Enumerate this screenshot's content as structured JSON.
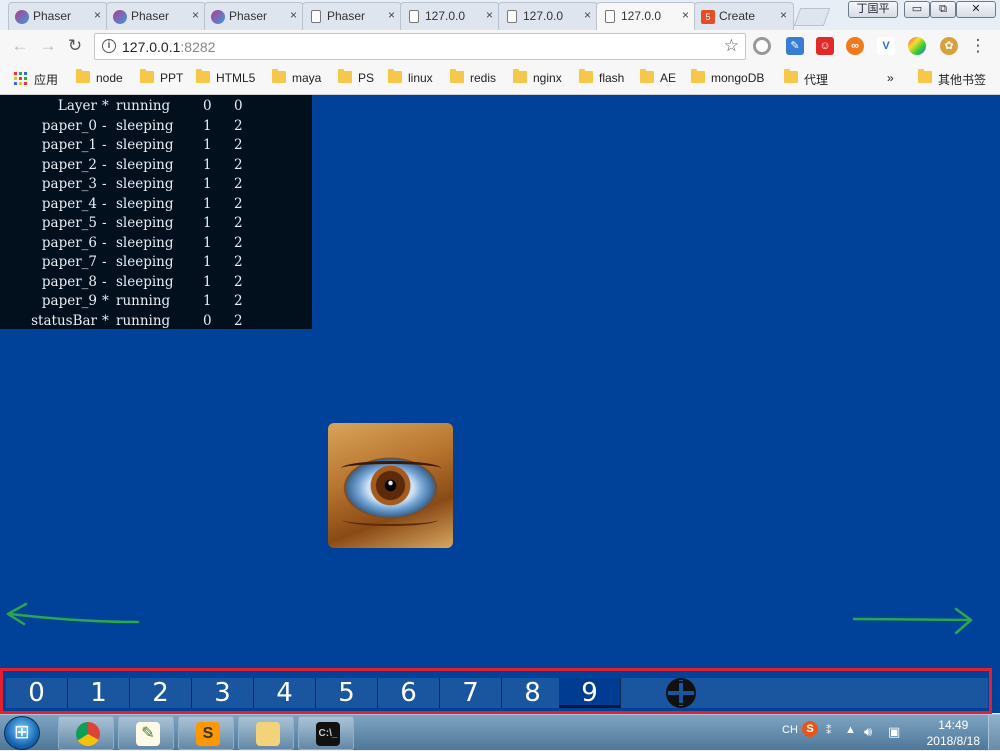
{
  "browser": {
    "tabs": [
      {
        "label": "Phaser",
        "icon": "phaser-icon"
      },
      {
        "label": "Phaser",
        "icon": "phaser-icon"
      },
      {
        "label": "Phaser",
        "icon": "phaser-icon"
      },
      {
        "label": "Phaser",
        "icon": "page-icon"
      },
      {
        "label": "127.0.0",
        "icon": "page-icon"
      },
      {
        "label": "127.0.0",
        "icon": "page-icon"
      },
      {
        "label": "127.0.0",
        "icon": "page-icon",
        "active": true
      },
      {
        "label": "Create",
        "icon": "html5-icon"
      }
    ],
    "tab_close": "×",
    "window_user": "丁国平",
    "window_min": "▭",
    "window_restore": "⧉",
    "window_close": "✕",
    "url_host": "127.0.0.1",
    "url_port": ":8282",
    "star_icon": "☆",
    "menu_icon": "⋮"
  },
  "bookmarks": {
    "apps_label": "应用",
    "items": [
      "node",
      "PPT",
      "HTML5",
      "maya",
      "PS",
      "linux",
      "redis",
      "nginx",
      "flash",
      "AE",
      "mongoDB",
      "代理"
    ],
    "overflow": "»",
    "other_label": "其他书签"
  },
  "debug_panel": {
    "rows": [
      {
        "name": "Layer",
        "sym": "*",
        "state": "running",
        "n1": "0",
        "n2": "0"
      },
      {
        "name": "paper_0",
        "sym": "-",
        "state": "sleeping",
        "n1": "1",
        "n2": "2"
      },
      {
        "name": "paper_1",
        "sym": "-",
        "state": "sleeping",
        "n1": "1",
        "n2": "2"
      },
      {
        "name": "paper_2",
        "sym": "-",
        "state": "sleeping",
        "n1": "1",
        "n2": "2"
      },
      {
        "name": "paper_3",
        "sym": "-",
        "state": "sleeping",
        "n1": "1",
        "n2": "2"
      },
      {
        "name": "paper_4",
        "sym": "-",
        "state": "sleeping",
        "n1": "1",
        "n2": "2"
      },
      {
        "name": "paper_5",
        "sym": "-",
        "state": "sleeping",
        "n1": "1",
        "n2": "2"
      },
      {
        "name": "paper_6",
        "sym": "-",
        "state": "sleeping",
        "n1": "1",
        "n2": "2"
      },
      {
        "name": "paper_7",
        "sym": "-",
        "state": "sleeping",
        "n1": "1",
        "n2": "2"
      },
      {
        "name": "paper_8",
        "sym": "-",
        "state": "sleeping",
        "n1": "1",
        "n2": "2"
      },
      {
        "name": "paper_9",
        "sym": "*",
        "state": "running",
        "n1": "1",
        "n2": "2"
      },
      {
        "name": "statusBar",
        "sym": "*",
        "state": "running",
        "n1": "0",
        "n2": "2"
      }
    ]
  },
  "statusbar": {
    "buttons": [
      "0",
      "1",
      "2",
      "3",
      "4",
      "5",
      "6",
      "7",
      "8",
      "9"
    ],
    "active_index": 9,
    "add_icon": "add-circle-icon"
  },
  "colors": {
    "game_bg": "#004299",
    "highlight": "#e5202e",
    "arrow": "#2aa84a"
  },
  "taskbar": {
    "apps": [
      "chrome-icon",
      "notepad-icon",
      "sublime-icon",
      "explorer-icon",
      "cmd-icon"
    ],
    "lang": "CH",
    "time": "14:49",
    "date": "2018/8/18"
  }
}
